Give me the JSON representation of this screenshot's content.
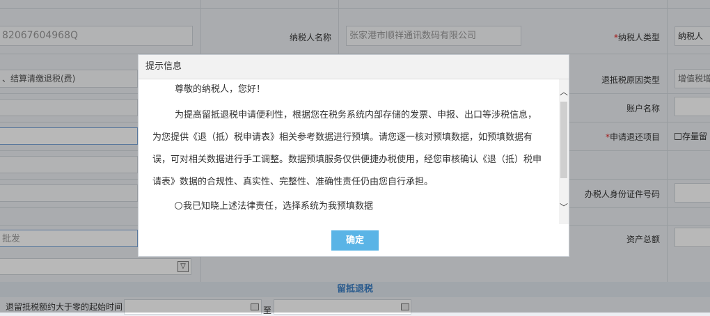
{
  "form": {
    "taxpayer_id_value": "82067604968Q",
    "taxpayer_name_label": "纳税人名称",
    "taxpayer_name_value": "张家港市顺祥通讯数码有限公司",
    "taxpayer_type_label": "纳税人类型",
    "taxpayer_type_value": "纳税人",
    "refund_type_value": "、结算清缴退税(费)",
    "refund_reason_label": "退抵税原因类型",
    "refund_reason_value": "增值税增",
    "account_name_label": "账户名称",
    "apply_items_label": "申请退还项目",
    "retained_checkbox_label": "存量留",
    "agent_id_label": "办税人身份证件号码",
    "approval_value": "批发",
    "total_assets_label": "资产总额",
    "section_title": "留抵退税",
    "bottom_left_text": "退留抵税额约大于零的起始时间",
    "bottom_mid_text": "至"
  },
  "dialog": {
    "title": "提示信息",
    "greeting": "尊敬的纳税人，您好！",
    "paragraph": "为提高留抵退税申请便利性，根据您在税务系统内部存储的发票、申报、出口等涉税信息，为您提供《退（抵）税申请表》相关参考数据进行预填。请您逐一核对预填数据，如预填数据有误，可对相关数据进行手工调整。数据预填服务仅供便捷办税使用，经您审核确认《退（抵）税申请表》数据的合规性、真实性、完整性、准确性责任仍由您自行承担。",
    "radio_label": "我已知晓上述法律责任，选择系统为我预填数据",
    "ok_label": "确定"
  }
}
